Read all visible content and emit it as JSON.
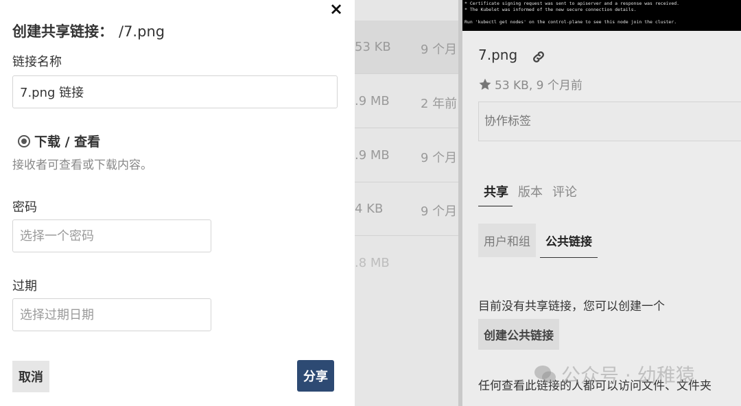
{
  "modal": {
    "close_label": "×",
    "title": "创建共享链接：",
    "title_file": "/7.png",
    "name_label": "链接名称",
    "name_value": "7.png 链接",
    "download_option": "下载 / 查看",
    "download_help": "接收者可查看或下载内容。",
    "password_label": "密码",
    "password_placeholder": "选择一个密码",
    "expiry_label": "过期",
    "expiry_placeholder": "选择过期日期",
    "cancel_label": "取消",
    "share_label": "分享",
    "accent_color": "#2d4a73"
  },
  "file_list": {
    "rows": [
      {
        "size": "53 KB",
        "date": "9 个月"
      },
      {
        "size": ".9 MB",
        "date": "2 年前"
      },
      {
        "size": ".9 MB",
        "date": "9 个月"
      },
      {
        "size": "4 KB",
        "date": "9 个月"
      },
      {
        "size": ".8 MB",
        "date": ""
      }
    ]
  },
  "terminal": {
    "lines": [
      "* Certificate signing request was sent to apiserver and a response was received.",
      "* The Kubelet was informed of the new secure connection details.",
      "",
      "Run 'kubectl get nodes' on the control-plane to see this node join the cluster."
    ]
  },
  "detail": {
    "file_name": "7.png",
    "meta": "53 KB, 9 个月前",
    "tags_placeholder": "协作标签",
    "tabs": [
      "共享",
      "版本",
      "评论"
    ],
    "subtabs": [
      "用户和组",
      "公共链接"
    ],
    "no_links_text": "目前没有共享链接，您可以创建一个",
    "create_link_label": "创建公共链接",
    "note_text": "任何查看此链接的人都可以访问文件、文件夹",
    "watermark": "公众号 · 幼稚猿"
  }
}
